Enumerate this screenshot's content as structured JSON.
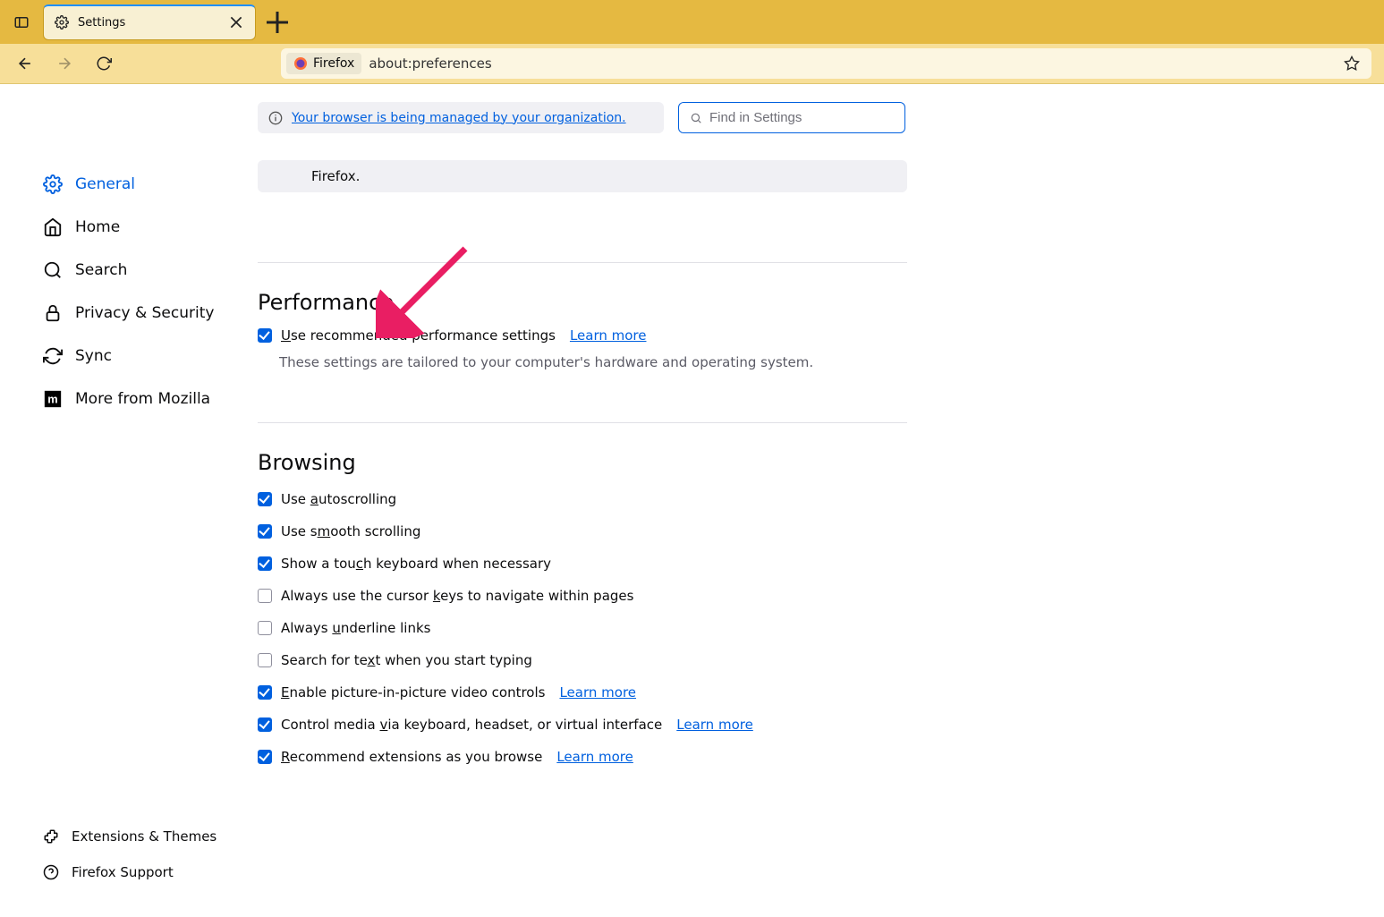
{
  "tab": {
    "title": "Settings"
  },
  "urlbar": {
    "identity_label": "Firefox",
    "url": "about:preferences"
  },
  "search": {
    "placeholder": "Find in Settings"
  },
  "policy_banner": "Your browser is being managed by your organization.",
  "categories": [
    {
      "id": "general",
      "label": "General",
      "selected": true
    },
    {
      "id": "home",
      "label": "Home"
    },
    {
      "id": "search",
      "label": "Search"
    },
    {
      "id": "privacy",
      "label": "Privacy & Security"
    },
    {
      "id": "sync",
      "label": "Sync"
    },
    {
      "id": "more",
      "label": "More from Mozilla"
    }
  ],
  "bottom_links": [
    {
      "id": "extensions",
      "label": "Extensions & Themes"
    },
    {
      "id": "support",
      "label": "Firefox Support"
    }
  ],
  "info_card": "Firefox.",
  "performance": {
    "heading": "Performance",
    "recommended": {
      "prefix": "U",
      "rest": "se recommended performance settings",
      "checked": true
    },
    "learn_more": "Learn more",
    "desc": "These settings are tailored to your computer's hardware and operating system."
  },
  "browsing": {
    "heading": "Browsing",
    "items": [
      {
        "prefix": "Use ",
        "u": "a",
        "rest": "utoscrolling",
        "checked": true,
        "learn": false
      },
      {
        "prefix": "Use s",
        "u": "m",
        "rest": "ooth scrolling",
        "checked": true,
        "learn": false
      },
      {
        "prefix": "Show a tou",
        "u": "c",
        "rest": "h keyboard when necessary",
        "checked": true,
        "learn": false
      },
      {
        "prefix": "Always use the cursor ",
        "u": "k",
        "rest": "eys to navigate within pages",
        "checked": false,
        "learn": false
      },
      {
        "prefix": "Always ",
        "u": "u",
        "rest": "nderline links",
        "checked": false,
        "learn": false
      },
      {
        "prefix": "Search for te",
        "u": "x",
        "rest": "t when you start typing",
        "checked": false,
        "learn": false
      },
      {
        "prefix": "",
        "u": "E",
        "rest": "nable picture-in-picture video controls",
        "checked": true,
        "learn": true
      },
      {
        "prefix": "Control media ",
        "u": "v",
        "rest": "ia keyboard, headset, or virtual interface",
        "checked": true,
        "learn": true
      },
      {
        "prefix": "",
        "u": "R",
        "rest": "ecommend extensions as you browse",
        "checked": true,
        "learn": true
      }
    ],
    "learn_more": "Learn more"
  }
}
